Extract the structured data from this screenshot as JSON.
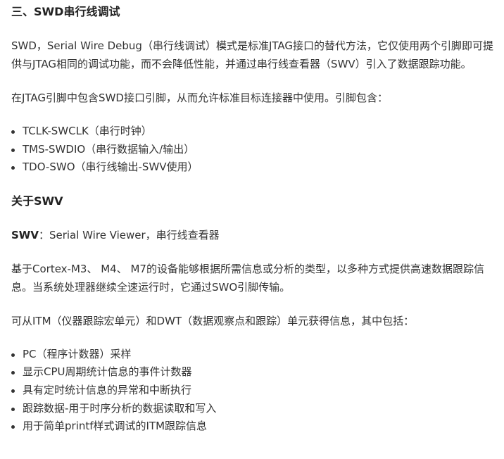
{
  "heading_swd": "三、SWD串行线调试",
  "para_swd": "SWD，Serial Wire Debug（串行线调试）模式是标准JTAG接口的替代方法，它仅使用两个引脚即可提供与JTAG相同的调试功能，而不会降低性能，并通过串行线查看器（SWV）引入了数据跟踪功能。",
  "para_pins": "在JTAG引脚中包含SWD接口引脚，从而允许标准目标连接器中使用。引脚包含：",
  "pin_list": [
    "TCLK-SWCLK（串行时钟）",
    "TMS-SWDIO（串行数据输入/输出）",
    "TDO-SWO（串行线输出-SWV使用）"
  ],
  "heading_swv": "关于SWV",
  "swv_def_term": "SWV",
  "swv_def_text": "：Serial Wire Viewer，串行线查看器",
  "para_cortex": "基于Cortex-M3、 M4、 M7的设备能够根据所需信息或分析的类型，以多种方式提供高速数据跟踪信息。当系统处理器继续全速运行时，它通过SWO引脚传输。",
  "para_itm": "可从ITM（仪器跟踪宏单元）和DWT（数据观察点和跟踪）单元获得信息，其中包括：",
  "info_list": [
    "PC（程序计数器）采样",
    "显示CPU周期统计信息的事件计数器",
    "具有定时统计信息的异常和中断执行",
    "跟踪数据-用于时序分析的数据读取和写入",
    "用于简单printf样式调试的ITM跟踪信息"
  ]
}
